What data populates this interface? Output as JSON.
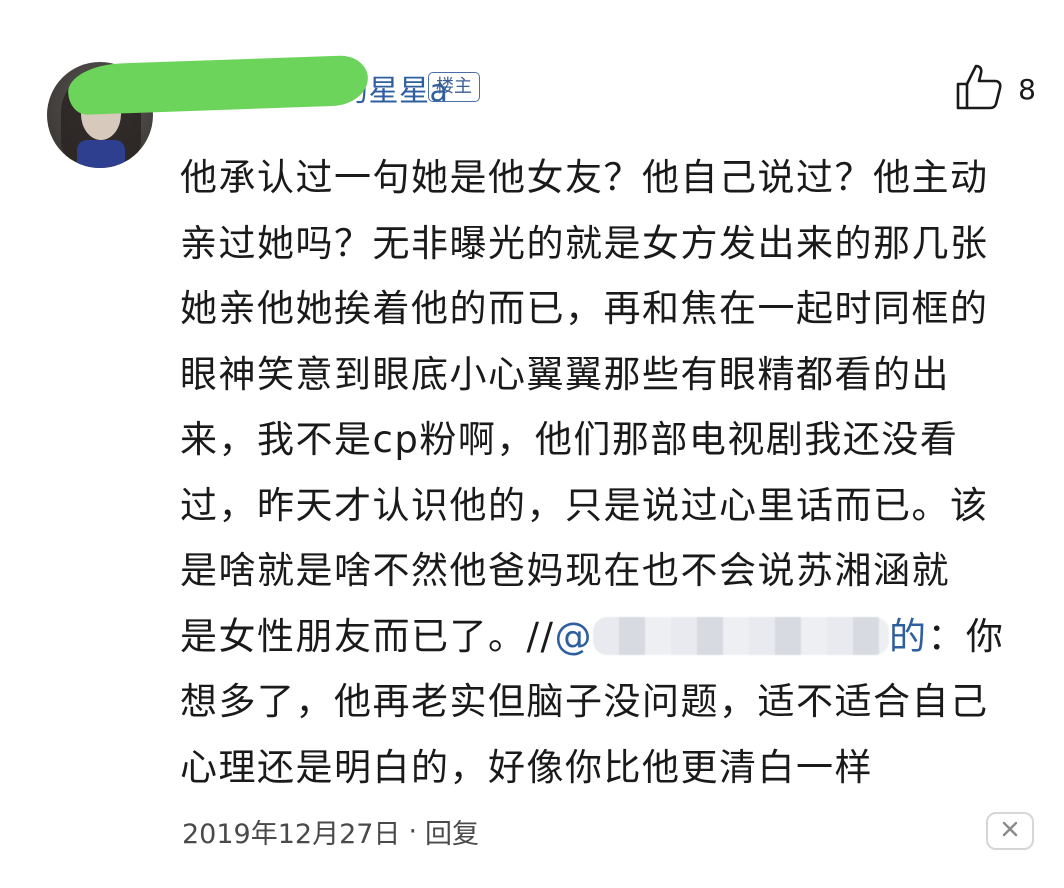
{
  "comment": {
    "username_visible_suffix": "的星星a",
    "op_badge": "楼主",
    "like_count": "8",
    "body_lines": [
      "他承认过一句她是他女友？他自己说过？他主动",
      "亲过她吗？无非曝光的就是女方发出来的那几张",
      "她亲他她挨着他的而已，再和焦在一起时同框的",
      "眼神笑意到眼底小心翼翼那些有眼精都看的出",
      "来，我不是cp粉啊，他们那部电视剧我还没看",
      "过，昨天才认识他的，只是说过心里话而已。该",
      "是啥就是啥不然他爸妈现在也不会说苏湘涵就"
    ],
    "line8_prefix": "是女性朋友而已了。//",
    "mention_start": "@",
    "mention_end": "的",
    "line8_suffix": "：你",
    "body_lines_after": [
      "想多了，他再老实但脑子没问题，适不适合自己",
      "心理还是明白的，好像你比他更清白一样"
    ],
    "date": "2019年12月27日",
    "separator": "·",
    "reply_label": "回复"
  },
  "icons": {
    "like": "thumbs-up-icon",
    "close": "close-icon"
  },
  "colors": {
    "username": "#2e5f9e",
    "mention": "#2e5f9e",
    "redaction_green": "#6cd45a"
  }
}
